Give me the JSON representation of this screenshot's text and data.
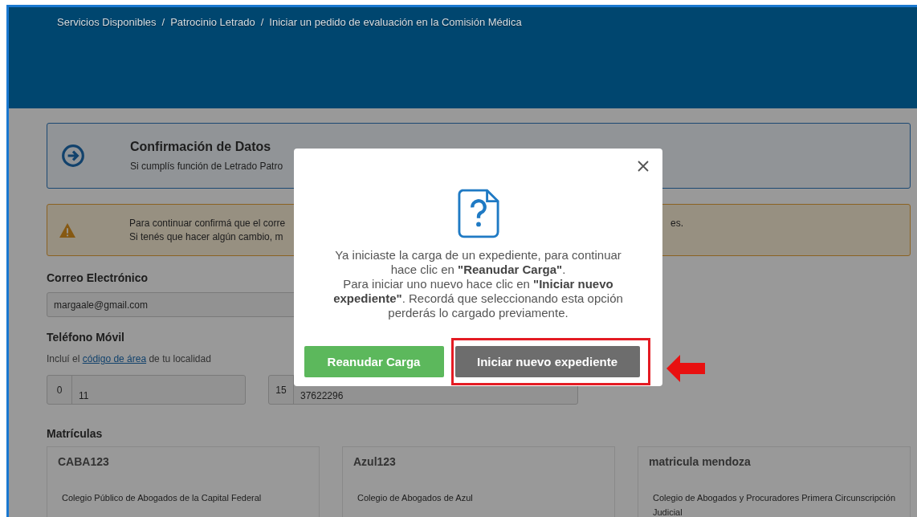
{
  "breadcrumb": {
    "separator": "/",
    "items": [
      {
        "label": "Servicios Disponibles"
      },
      {
        "label": "Patrocinio Letrado"
      },
      {
        "label": "Iniciar un pedido de evaluación en la Comisión Médica"
      }
    ]
  },
  "info_notice": {
    "title": "Confirmación de Datos",
    "text": "Si cumplís función de Letrado Patro"
  },
  "warning_notice": {
    "lines": [
      {
        "left": "Para continuar confirmá que el corre",
        "right": "es."
      },
      {
        "left": "Si tenés que hacer algún cambio, m"
      }
    ]
  },
  "email": {
    "label": "Correo Electrónico",
    "value": "margaale@gmail.com"
  },
  "phone": {
    "label": "Teléfono Móvil",
    "hint_before": "Incluí el",
    "hint_link": "código de área",
    "hint_after": "de tu localidad",
    "fields": [
      {
        "prefix": "0",
        "value": "11"
      },
      {
        "prefix": "15",
        "value": "37622296"
      }
    ]
  },
  "registrations": {
    "title": "Matrículas",
    "items": [
      {
        "name": "CABA123",
        "college": "Colegio Público de Abogados de la Capital Federal"
      },
      {
        "name": "Azul123",
        "college": "Colegio de Abogados de Azul"
      },
      {
        "name": "matricula mendoza",
        "college": "Colegio de Abogados y Procuradores Primera Circunscripción Judicial"
      }
    ]
  },
  "modal": {
    "paragraphs": [
      "Ya iniciaste la carga de un expediente, para continuar hace clic en **\"Reanudar Carga\"**.",
      "Para iniciar uno nuevo hace clic en **\"Iniciar nuevo expediente\"**. Recordá que seleccionando esta opción perderás lo cargado previamente."
    ],
    "buttons": [
      {
        "label": "Reanudar Carga",
        "kind": "primary",
        "highlighted": false
      },
      {
        "label": "Iniciar nuevo expediente",
        "kind": "secondary",
        "highlighted": true
      }
    ]
  }
}
